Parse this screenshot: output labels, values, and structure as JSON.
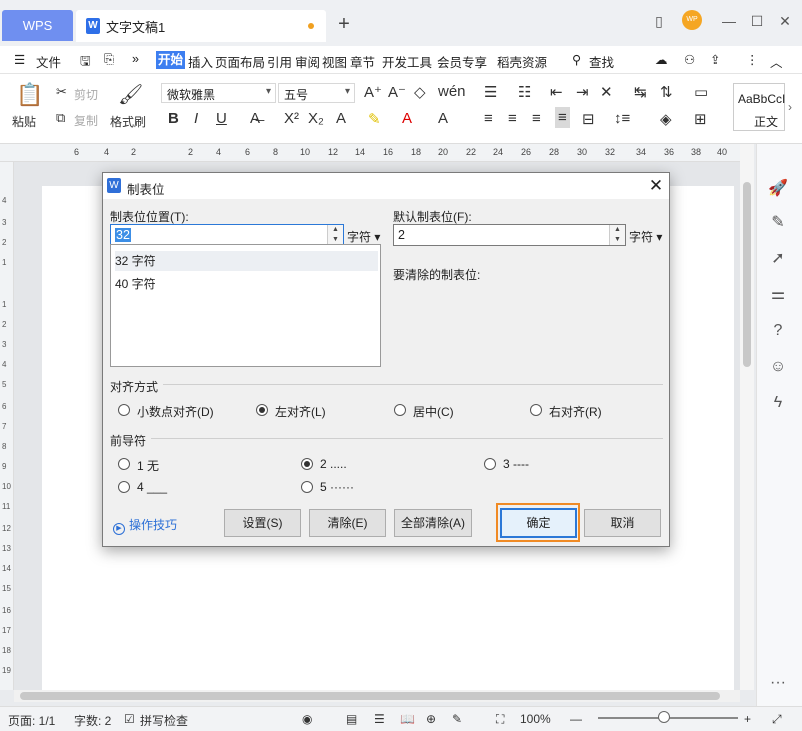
{
  "titlebar": {
    "app_tab": "WPS",
    "doc_tab": "文字文稿1",
    "new_tab": "+"
  },
  "menu": {
    "file": "文件",
    "items": [
      "开始",
      "插入",
      "页面布局",
      "引用",
      "审阅",
      "视图",
      "章节",
      "开发工具",
      "会员专享",
      "稻壳资源"
    ],
    "search": "查找"
  },
  "ribbon": {
    "paste": "粘贴",
    "cut": "剪切",
    "copy": "复制",
    "format_painter": "格式刷",
    "font_name": "微软雅黑",
    "font_size": "五号",
    "style_preview": "AaBbCcI",
    "style_name": "正文"
  },
  "ruler": {
    "ticks": [
      "6",
      "4",
      "2",
      "2",
      "4",
      "6",
      "8",
      "10",
      "12",
      "14",
      "16",
      "18",
      "20",
      "22",
      "24",
      "26",
      "28",
      "30",
      "32",
      "34",
      "36",
      "38",
      "40"
    ],
    "vticks": [
      "4",
      "3",
      "2",
      "1",
      "1",
      "2",
      "3",
      "4",
      "5",
      "6",
      "7",
      "8",
      "9",
      "10",
      "11",
      "12",
      "13",
      "14",
      "15",
      "16",
      "17",
      "18",
      "19"
    ]
  },
  "dialog": {
    "title": "制表位",
    "tab_pos_label": "制表位位置(T):",
    "tab_pos_value": "32",
    "unit": "字符",
    "default_label": "默认制表位(F):",
    "default_value": "2",
    "clear_label": "要清除的制表位:",
    "list": [
      "32 字符",
      "40 字符"
    ],
    "align_group": "对齐方式",
    "align_options": [
      "小数点对齐(D)",
      "左对齐(L)",
      "居中(C)",
      "右对齐(R)"
    ],
    "align_selected": "左对齐(L)",
    "leader_group": "前导符",
    "leader_options": [
      "1 无",
      "2 .....",
      "3 ----",
      "4 ___",
      "5 ······"
    ],
    "leader_selected": "2 .....",
    "tips": "操作技巧",
    "btn_set": "设置(S)",
    "btn_clear": "清除(E)",
    "btn_clear_all": "全部清除(A)",
    "btn_ok": "确定",
    "btn_cancel": "取消"
  },
  "status": {
    "page": "页面: 1/1",
    "words": "字数: 2",
    "spell": "拼写检查",
    "zoom": "100%"
  },
  "colors": {
    "accent": "#3c7ef0",
    "highlight": "#f08a24"
  }
}
